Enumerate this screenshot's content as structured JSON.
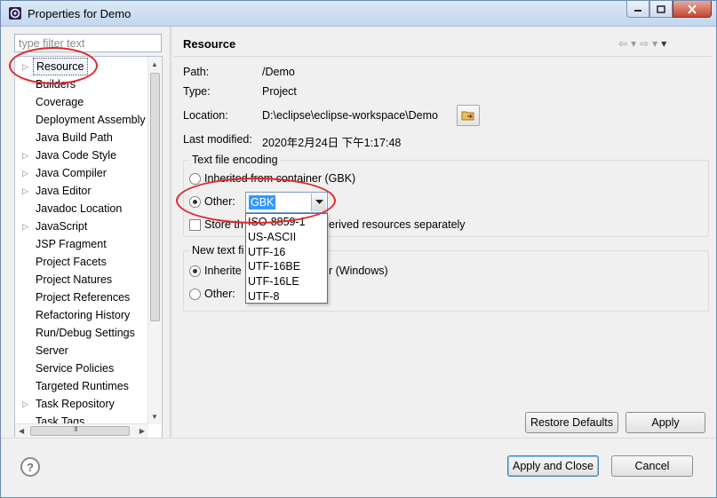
{
  "window": {
    "title": "Properties for Demo"
  },
  "left": {
    "filter_placeholder": "type filter text",
    "tree": [
      {
        "label": "Resource",
        "expandable": true,
        "selected": true
      },
      {
        "label": "Builders",
        "expandable": false
      },
      {
        "label": "Coverage",
        "expandable": false
      },
      {
        "label": "Deployment Assembly",
        "expandable": false
      },
      {
        "label": "Java Build Path",
        "expandable": false
      },
      {
        "label": "Java Code Style",
        "expandable": true
      },
      {
        "label": "Java Compiler",
        "expandable": true
      },
      {
        "label": "Java Editor",
        "expandable": true
      },
      {
        "label": "Javadoc Location",
        "expandable": false
      },
      {
        "label": "JavaScript",
        "expandable": true
      },
      {
        "label": "JSP Fragment",
        "expandable": false
      },
      {
        "label": "Project Facets",
        "expandable": false
      },
      {
        "label": "Project Natures",
        "expandable": false
      },
      {
        "label": "Project References",
        "expandable": false
      },
      {
        "label": "Refactoring History",
        "expandable": false
      },
      {
        "label": "Run/Debug Settings",
        "expandable": false
      },
      {
        "label": "Server",
        "expandable": false
      },
      {
        "label": "Service Policies",
        "expandable": false
      },
      {
        "label": "Targeted Runtimes",
        "expandable": false
      },
      {
        "label": "Task Repository",
        "expandable": true
      },
      {
        "label": "Task Tags",
        "expandable": false
      }
    ],
    "hscroll_grip": "III"
  },
  "page": {
    "title": "Resource",
    "path_label": "Path:",
    "path_value": "/Demo",
    "type_label": "Type:",
    "type_value": "Project",
    "location_label": "Location:",
    "location_value": "D:\\eclipse\\eclipse-workspace\\Demo",
    "modified_label": "Last modified:",
    "modified_value": "2020年2月24日 下午1:17:48",
    "encoding_group": {
      "legend": "Text file encoding",
      "inherited_label": "Inherited from container (GBK)",
      "other_label": "Other:",
      "selected_value": "GBK",
      "store_label_prefix": "Store th",
      "store_label_suffix": "erived resources separately",
      "options": [
        "ISO-8859-1",
        "US-ASCII",
        "UTF-16",
        "UTF-16BE",
        "UTF-16LE",
        "UTF-8"
      ]
    },
    "delimiter_group": {
      "legend": "New text fi",
      "inherited_prefix": "Inherite",
      "inherited_suffix": "r (Windows)",
      "other_label": "Other:"
    }
  },
  "buttons": {
    "restore_defaults": "Restore Defaults",
    "apply": "Apply",
    "apply_and_close": "Apply and Close",
    "cancel": "Cancel",
    "help": "?"
  },
  "colors": {
    "annotation_red": "#e0262d",
    "selection_blue": "#3399ff"
  }
}
